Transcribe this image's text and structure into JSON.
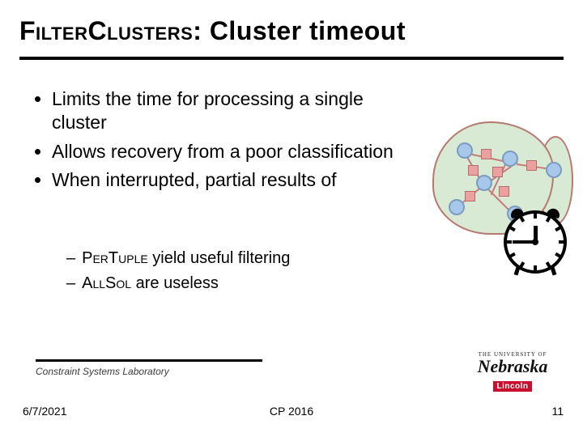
{
  "title": {
    "word1": "Filter",
    "word2": "Clusters",
    "rest": ": Cluster timeout"
  },
  "bullets": [
    "Limits the time for processing a single cluster",
    "Allows recovery from a poor classification",
    "When interrupted, partial results of"
  ],
  "sub": [
    {
      "sc": "PerTuple",
      "rest": " yield useful filtering"
    },
    {
      "sc": "AllSol",
      "rest": " are useless"
    }
  ],
  "footer": {
    "lab": "Constraint Systems Laboratory",
    "date": "6/7/2021",
    "center": "CP 2016",
    "page": "11"
  },
  "logo": {
    "top": "THE UNIVERSITY OF",
    "main": "Nebraska",
    "bottom": "Lincoln"
  }
}
